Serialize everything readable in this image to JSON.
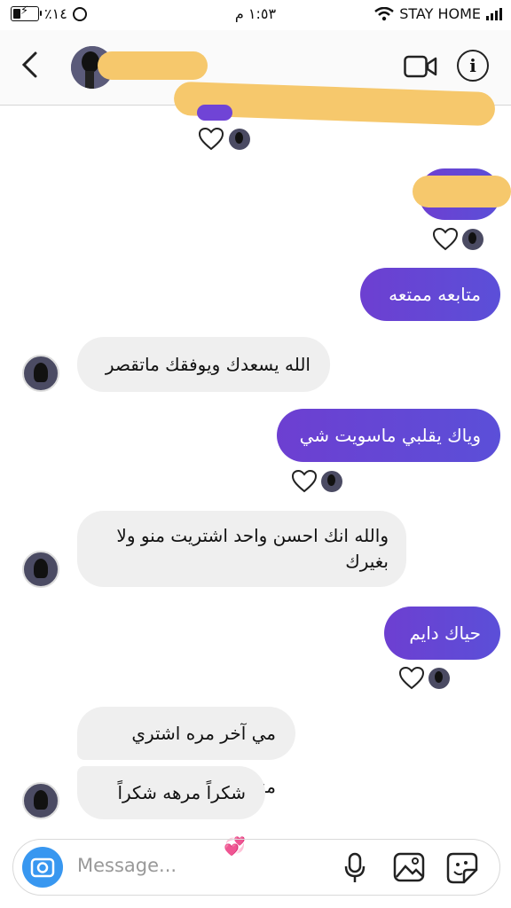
{
  "status_bar": {
    "battery": "٪١٤",
    "time": "١:٥٣ م",
    "carrier": "STAY HOME"
  },
  "header": {
    "back_icon": "chevron-left-icon",
    "video_icon": "video-call-icon",
    "info_icon": "info-icon",
    "info_glyph": "i"
  },
  "messages": [
    {
      "direction": "outgoing",
      "text": "متابعه ممتعه"
    },
    {
      "direction": "incoming",
      "text": "الله يسعدك ويوفقك ماتقصر"
    },
    {
      "direction": "outgoing",
      "text": "وياك يقلبي ماسويت شي"
    },
    {
      "direction": "incoming",
      "text": "والله انك احسن واحد اشتريت منو ولا بغيرك"
    },
    {
      "direction": "outgoing",
      "text": "حياك دايم"
    },
    {
      "direction": "incoming",
      "text": "مي آخر مره اشتري منك"
    },
    {
      "direction": "incoming",
      "text": "شكراً مرهه شكراً💞"
    }
  ],
  "composer": {
    "placeholder": "Message...",
    "camera_icon": "camera-icon",
    "mic_icon": "microphone-icon",
    "gallery_icon": "gallery-icon",
    "sticker_icon": "sticker-icon"
  },
  "colors": {
    "outgoing_bubble": "#6d3fd1",
    "incoming_bubble": "#efefef",
    "camera_button": "#3897f0",
    "redaction": "#f6c86c"
  }
}
